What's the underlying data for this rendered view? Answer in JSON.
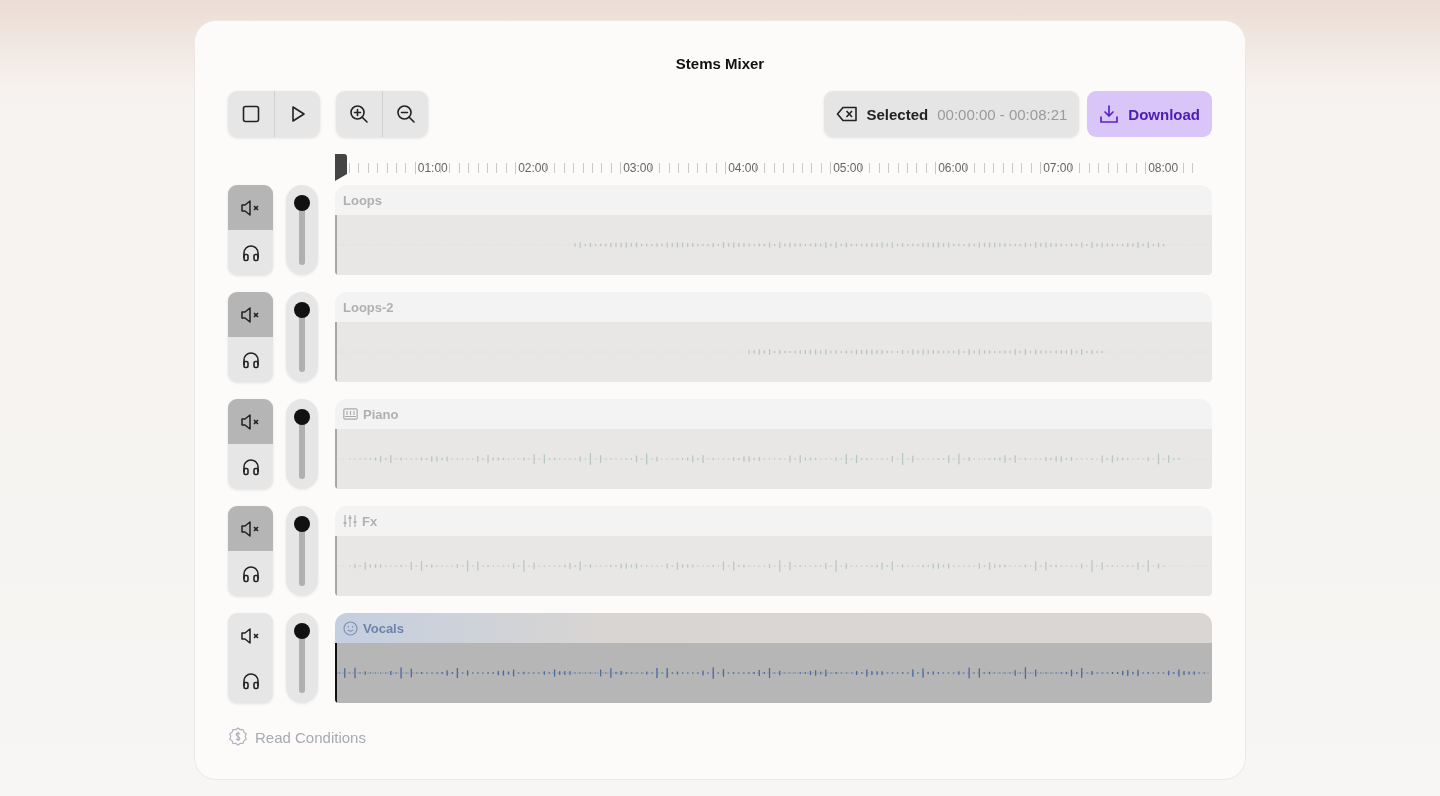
{
  "title": "Stems Mixer",
  "selection": {
    "label": "Selected",
    "range": "00:00:00 - 00:08:21"
  },
  "download": "Download",
  "ruler": [
    "01:00",
    "02:00",
    "03:00",
    "04:00",
    "05:00",
    "06:00",
    "07:00",
    "08:00"
  ],
  "tracks": [
    {
      "name": "Loops",
      "kind": "plain",
      "muted": true,
      "level": 1,
      "selected": false
    },
    {
      "name": "Loops-2",
      "kind": "plain",
      "muted": true,
      "level": 1,
      "selected": false
    },
    {
      "name": "Piano",
      "kind": "piano",
      "muted": true,
      "level": 1,
      "selected": false
    },
    {
      "name": "Fx",
      "kind": "fx",
      "muted": true,
      "level": 1,
      "selected": false
    },
    {
      "name": "Vocals",
      "kind": "vocals",
      "muted": false,
      "level": 1,
      "selected": true
    }
  ],
  "footer": "Read Conditions"
}
